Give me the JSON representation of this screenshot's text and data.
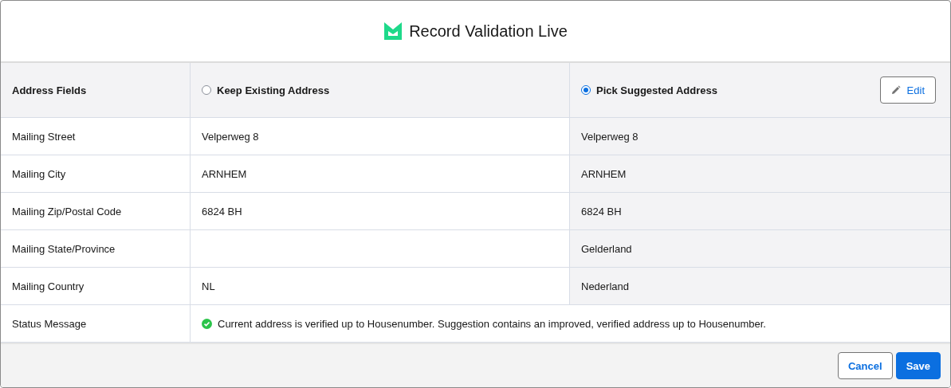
{
  "modal": {
    "title": "Record Validation Live"
  },
  "table": {
    "columns": [
      {
        "label": "Address Fields",
        "kind": "label"
      },
      {
        "label": "Keep Existing Address",
        "kind": "option",
        "selected": false
      },
      {
        "label": "Pick Suggested Address",
        "kind": "option",
        "selected": true,
        "action": "Edit"
      }
    ],
    "rows": [
      {
        "field": "Mailing Street",
        "existing": "Velperweg 8",
        "suggested": "Velperweg 8"
      },
      {
        "field": "Mailing City",
        "existing": "ARNHEM",
        "suggested": "ARNHEM"
      },
      {
        "field": "Mailing Zip/Postal Code",
        "existing": "6824 BH",
        "suggested": "6824 BH"
      },
      {
        "field": "Mailing State/Province",
        "existing": "",
        "suggested": "Gelderland"
      },
      {
        "field": "Mailing Country",
        "existing": "NL",
        "suggested": "Nederland"
      }
    ],
    "status": {
      "field": "Status Message",
      "kind": "success",
      "message": "Current address is verified up to Housenumber. Suggestion contains an improved, verified address up to Housenumber."
    }
  },
  "buttons": [
    {
      "label": "Cancel",
      "kind": "neutral"
    },
    {
      "label": "Save",
      "kind": "brand"
    }
  ]
}
